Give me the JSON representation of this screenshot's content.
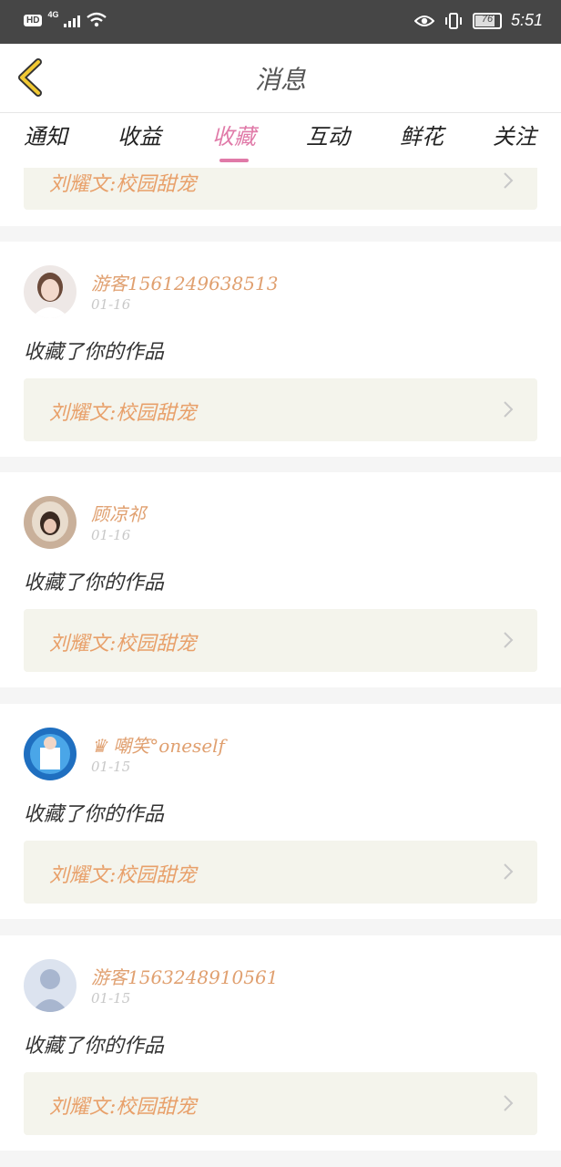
{
  "status": {
    "battery": "76",
    "time": "5:51",
    "network": "4G",
    "hd": "HD"
  },
  "header": {
    "title": "消息"
  },
  "tabs": [
    "通知",
    "收益",
    "收藏",
    "互动",
    "鲜花",
    "关注"
  ],
  "active_tab": "收藏",
  "work_title": "刘耀文:校园甜宠",
  "items": [
    {
      "user": "游客1561249638513",
      "date": "01-16",
      "message": "收藏了你的作品",
      "work": "刘耀文:校园甜宠"
    },
    {
      "user": "顾凉祁",
      "date": "01-16",
      "message": "收藏了你的作品",
      "work": "刘耀文:校园甜宠"
    },
    {
      "user": "\u0003嘲笑°oneself",
      "date": "01-15",
      "message": "收藏了你的作品",
      "work": "刘耀文:校园甜宠"
    },
    {
      "user": "游客1563248910561",
      "date": "01-15",
      "message": "收藏了你的作品",
      "work": "刘耀文:校园甜宠"
    }
  ],
  "colors": {
    "accent": "#e07aa8",
    "username": "#e0a070",
    "work_text": "#e8a06a",
    "work_bg": "#f4f4ec"
  }
}
